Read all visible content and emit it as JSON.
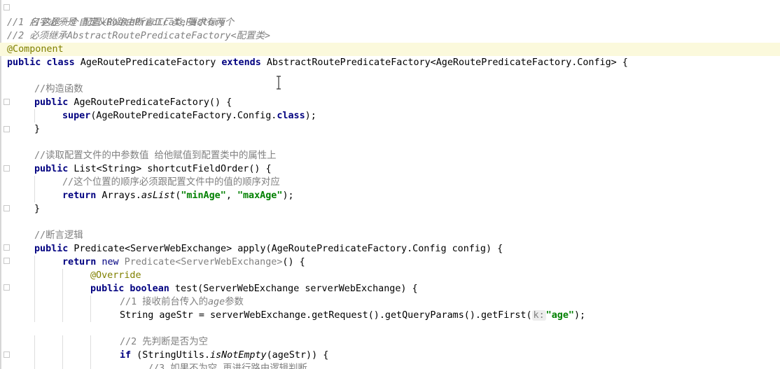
{
  "code": {
    "c1": "//这是一个自定义的路由断言工厂类,要求有两个",
    "c2a": "//1 名字必须是 配置",
    "c2b": "+RoutePredicateFactory",
    "c3a": "//2 必须继承",
    "c3b": "AbstractRoutePredicateFactory",
    "c3c": "<配置类>",
    "ann_component": "@Component",
    "class_kw": "public class",
    "class_name": " AgeRoutePredicateFactory ",
    "extends_kw": "extends",
    "class_rest": " AbstractRoutePredicateFactory<AgeRoutePredicateFactory.Config> {",
    "c_ctor": "//构造函数",
    "ctor_kw": "public",
    "ctor_rest": " AgeRoutePredicateFactory() {",
    "super_kw": "super",
    "super_mid": "(AgeRoutePredicateFactory.Config.",
    "class_kw2": "class",
    "super_end": ");",
    "close1": "}",
    "c_read": "//读取配置文件的中参数值 给他赋值到配置类中的属性上",
    "sfo_kw": "public",
    "sfo_rest": " List<String> shortcutFieldOrder() {",
    "c_order": "//这个位置的顺序必须跟配置文件中的值的顺序对应",
    "ret_kw": "return",
    "ret_mid": " Arrays.",
    "ret_aslist": "asList",
    "ret_open": "(",
    "str_min": "\"minAge\"",
    "ret_comma": ", ",
    "str_max": "\"maxAge\"",
    "ret_end": ");",
    "close2": "}",
    "c_logic": "//断言逻辑",
    "apply_kw": "public",
    "apply_rest": " Predicate<ServerWebExchange> apply(AgeRoutePredicateFactory.Config config) {",
    "ret2_kw": "return",
    "new_kw": " new",
    "ret2_gen": " Predicate<ServerWebExchange>",
    "ret2_end": "() {",
    "ann_override": "@Override",
    "test_kw": "public boolean",
    "test_rest": " test(ServerWebExchange serverWebExchange) {",
    "c_recv_a": "//1 接收前台传入的",
    "c_recv_b": "age",
    "c_recv_c": "参数",
    "agestr_a": "String ageStr = serverWebExchange.getRequest().getQueryParams().getFirst(",
    "hint_k": "k:",
    "str_age": "\"age\"",
    "agestr_end": ");",
    "c_check": "//2 先判断是否为空",
    "if_kw": "if",
    "if_mid": " (StringUtils.",
    "if_method": "isNotEmpty",
    "if_end": "(ageStr)) {",
    "c_next": "//3 如果不为空,再进行路由逻辑判断"
  }
}
